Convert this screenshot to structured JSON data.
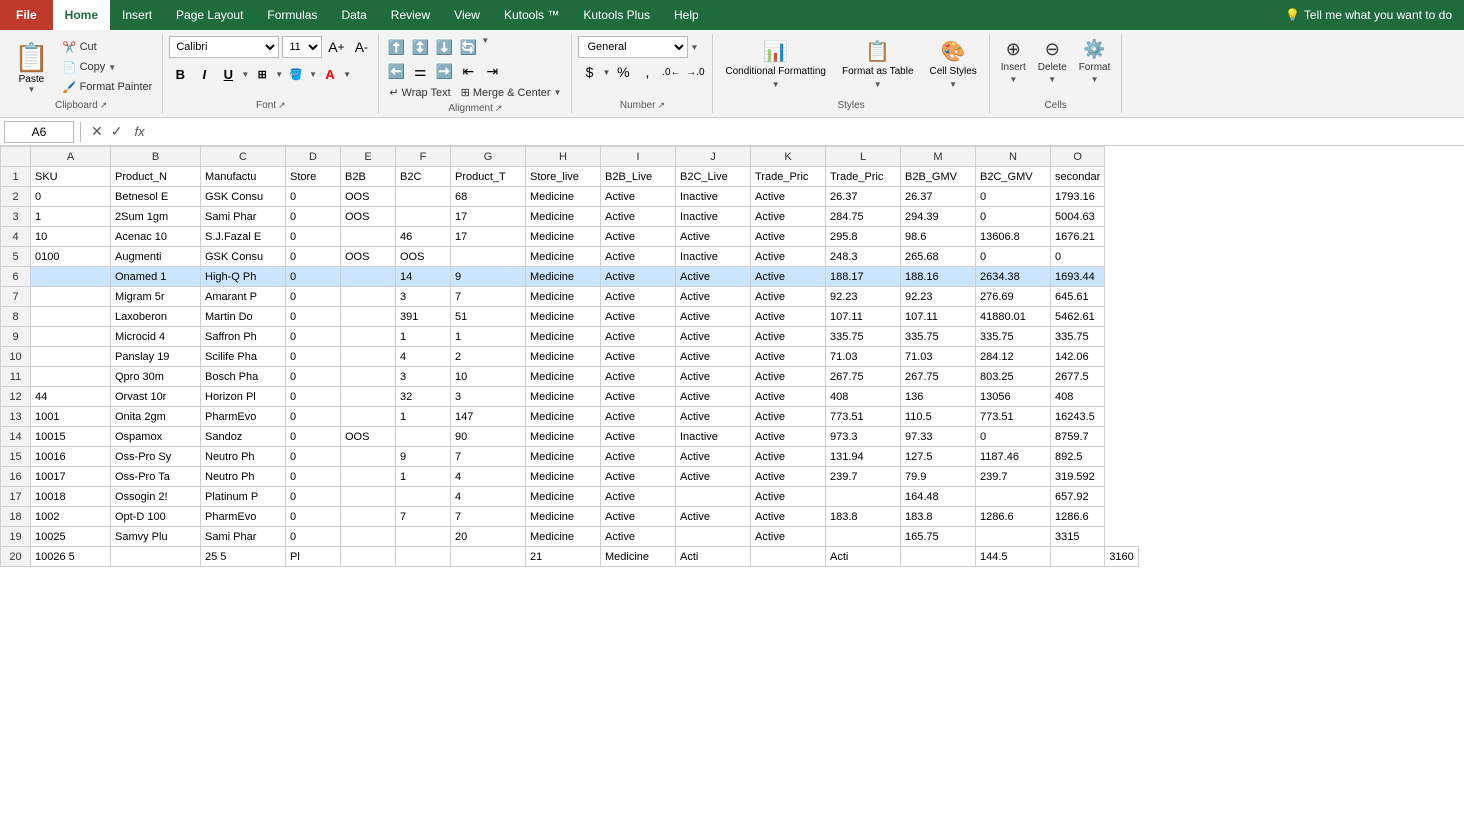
{
  "tabs": {
    "items": [
      {
        "label": "File",
        "type": "file"
      },
      {
        "label": "Home",
        "type": "active"
      },
      {
        "label": "Insert",
        "type": "normal"
      },
      {
        "label": "Page Layout",
        "type": "normal"
      },
      {
        "label": "Formulas",
        "type": "normal"
      },
      {
        "label": "Data",
        "type": "normal"
      },
      {
        "label": "Review",
        "type": "normal"
      },
      {
        "label": "View",
        "type": "normal"
      },
      {
        "label": "Kutools ™",
        "type": "normal"
      },
      {
        "label": "Kutools Plus",
        "type": "normal"
      },
      {
        "label": "Help",
        "type": "normal"
      }
    ],
    "tellme": "Tell me what you want to do"
  },
  "ribbon": {
    "clipboard": {
      "label": "Clipboard",
      "paste": "Paste",
      "cut": "Cut",
      "copy": "Copy",
      "format_painter": "Format Painter"
    },
    "font": {
      "label": "Font",
      "name": "Calibri",
      "size": "11"
    },
    "alignment": {
      "label": "Alignment",
      "wrap_text": "Wrap Text",
      "merge_center": "Merge & Center"
    },
    "number": {
      "label": "Number",
      "format": "General"
    },
    "styles": {
      "label": "Styles",
      "conditional": "Conditional Formatting",
      "format_as_table": "Format as Table",
      "cell_styles": "Cell Styles"
    },
    "cells": {
      "label": "Cells",
      "insert": "Insert",
      "delete": "Delete",
      "format": "Format"
    }
  },
  "formula_bar": {
    "cell_ref": "A6",
    "fx": "fx"
  },
  "headers": [
    "",
    "A",
    "B",
    "C",
    "D",
    "E",
    "F",
    "G",
    "H",
    "I",
    "J",
    "K",
    "L",
    "M",
    "N",
    "O"
  ],
  "col_headers": [
    "SKU",
    "Product_N",
    "Manufactu",
    "Store",
    "B2B",
    "B2C",
    "Product_T",
    "Store_live",
    "B2B_Live",
    "B2C_Live",
    "Trade_Pric",
    "Trade_Pric",
    "B2B_GMV",
    "B2C_GMV",
    "secondar"
  ],
  "rows": [
    [
      "2",
      "0",
      "Betnesol E",
      "GSK Consu",
      "0",
      "OOS",
      "",
      "68",
      "Medicine",
      "Active",
      "Inactive",
      "Active",
      "26.37",
      "26.37",
      "0",
      "1793.16"
    ],
    [
      "3",
      "1",
      "2Sum 1gm",
      "Sami Phar",
      "0",
      "OOS",
      "",
      "17",
      "Medicine",
      "Active",
      "Inactive",
      "Active",
      "284.75",
      "294.39",
      "0",
      "5004.63"
    ],
    [
      "4",
      "10",
      "Acenac 10",
      "S.J.Fazal E",
      "0",
      "",
      "46",
      "17",
      "Medicine",
      "Active",
      "Active",
      "Active",
      "295.8",
      "98.6",
      "13606.8",
      "1676.21"
    ],
    [
      "5",
      "0100",
      "Augmenti",
      "GSK Consu",
      "0",
      "OOS",
      "OOS",
      "",
      "Medicine",
      "Active",
      "Inactive",
      "Active",
      "248.3",
      "265.68",
      "0",
      "0"
    ],
    [
      "6",
      "",
      "Onamed 1",
      "High-Q Ph",
      "0",
      "",
      "14",
      "9",
      "Medicine",
      "Active",
      "Active",
      "Active",
      "188.17",
      "188.16",
      "2634.38",
      "1693.44"
    ],
    [
      "7",
      "",
      "Migram 5r",
      "Amarant P",
      "0",
      "",
      "3",
      "7",
      "Medicine",
      "Active",
      "Active",
      "Active",
      "92.23",
      "92.23",
      "276.69",
      "645.61"
    ],
    [
      "8",
      "",
      "Laxoberon",
      "Martin Do",
      "0",
      "",
      "391",
      "51",
      "Medicine",
      "Active",
      "Active",
      "Active",
      "107.11",
      "107.11",
      "41880.01",
      "5462.61"
    ],
    [
      "9",
      "",
      "Microcid 4",
      "Saffron Ph",
      "0",
      "",
      "1",
      "1",
      "Medicine",
      "Active",
      "Active",
      "Active",
      "335.75",
      "335.75",
      "335.75",
      "335.75"
    ],
    [
      "10",
      "",
      "Panslay 19",
      "Scilife Pha",
      "0",
      "",
      "4",
      "2",
      "Medicine",
      "Active",
      "Active",
      "Active",
      "71.03",
      "71.03",
      "284.12",
      "142.06"
    ],
    [
      "11",
      "",
      "Qpro 30m",
      "Bosch Pha",
      "0",
      "",
      "3",
      "10",
      "Medicine",
      "Active",
      "Active",
      "Active",
      "267.75",
      "267.75",
      "803.25",
      "2677.5"
    ],
    [
      "12",
      "44",
      "Orvast 10r",
      "Horizon Pl",
      "0",
      "",
      "32",
      "3",
      "Medicine",
      "Active",
      "Active",
      "Active",
      "408",
      "136",
      "13056",
      "408"
    ],
    [
      "13",
      "1001",
      "Onita 2gm",
      "PharmEvo",
      "0",
      "",
      "1",
      "147",
      "Medicine",
      "Active",
      "Active",
      "Active",
      "773.51",
      "110.5",
      "773.51",
      "16243.5"
    ],
    [
      "14",
      "10015",
      "Ospamox",
      "Sandoz",
      "0",
      "OOS",
      "",
      "90",
      "Medicine",
      "Active",
      "Inactive",
      "Active",
      "973.3",
      "97.33",
      "0",
      "8759.7"
    ],
    [
      "15",
      "10016",
      "Oss-Pro Sy",
      "Neutro Ph",
      "0",
      "",
      "9",
      "7",
      "Medicine",
      "Active",
      "Active",
      "Active",
      "131.94",
      "127.5",
      "1187.46",
      "892.5"
    ],
    [
      "16",
      "10017",
      "Oss-Pro Ta",
      "Neutro Ph",
      "0",
      "",
      "1",
      "4",
      "Medicine",
      "Active",
      "Active",
      "Active",
      "239.7",
      "79.9",
      "239.7",
      "319.592"
    ],
    [
      "17",
      "10018",
      "Ossogin 2!",
      "Platinum P",
      "0",
      "",
      "",
      "4",
      "Medicine",
      "Active",
      "",
      "Active",
      "",
      "164.48",
      "",
      "657.92"
    ],
    [
      "18",
      "1002",
      "Opt-D 100",
      "PharmEvo",
      "0",
      "",
      "7",
      "7",
      "Medicine",
      "Active",
      "Active",
      "Active",
      "183.8",
      "183.8",
      "1286.6",
      "1286.6"
    ],
    [
      "19",
      "10025",
      "Samvy Plu",
      "Sami Phar",
      "0",
      "",
      "",
      "20",
      "Medicine",
      "Active",
      "",
      "Active",
      "",
      "165.75",
      "",
      "3315"
    ],
    [
      "20",
      "10026 5",
      "",
      "25 5",
      "Pl",
      "",
      "",
      "",
      "21",
      "Medicine",
      "Acti",
      "",
      "Acti",
      "",
      "144.5",
      "",
      "3160"
    ]
  ]
}
